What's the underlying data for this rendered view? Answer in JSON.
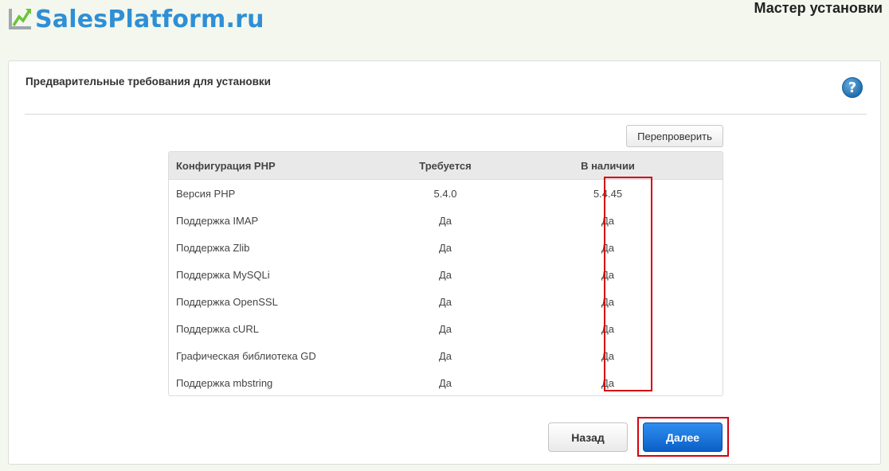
{
  "header": {
    "logo_text": "SalesPlatform.ru",
    "wizard_title": "Мастер установки"
  },
  "panel": {
    "heading": "Предварительные требования для установки",
    "help_icon": "question-circle-icon",
    "help_glyph": "?",
    "recheck_label": "Перепроверить"
  },
  "table": {
    "columns": [
      "Конфигурация PHP",
      "Требуется",
      "В наличии"
    ],
    "rows": [
      {
        "name": "Версия PHP",
        "required": "5.4.0",
        "available": "5.4.45"
      },
      {
        "name": "Поддержка IMAP",
        "required": "Да",
        "available": "Да"
      },
      {
        "name": "Поддержка Zlib",
        "required": "Да",
        "available": "Да"
      },
      {
        "name": "Поддержка MySQLi",
        "required": "Да",
        "available": "Да"
      },
      {
        "name": "Поддержка OpenSSL",
        "required": "Да",
        "available": "Да"
      },
      {
        "name": "Поддержка cURL",
        "required": "Да",
        "available": "Да"
      },
      {
        "name": "Графическая библиотека GD",
        "required": "Да",
        "available": "Да"
      },
      {
        "name": "Поддержка mbstring",
        "required": "Да",
        "available": "Да"
      }
    ]
  },
  "footer": {
    "back_label": "Назад",
    "next_label": "Далее"
  },
  "colors": {
    "background": "#f3f7ed",
    "brand": "#2e8fd6",
    "primary_button": "#0b5fc7",
    "highlight": "#d4000f"
  }
}
